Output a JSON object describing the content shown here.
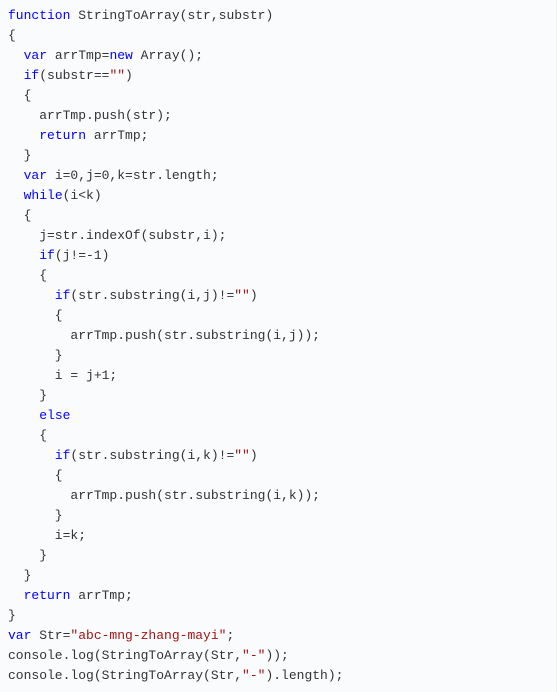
{
  "code": {
    "lines": [
      {
        "indent": 0,
        "tokens": [
          {
            "t": "function",
            "c": "kw"
          },
          {
            "t": " StringToArray(str,substr)"
          }
        ]
      },
      {
        "indent": 0,
        "tokens": [
          {
            "t": "{"
          }
        ]
      },
      {
        "indent": 1,
        "tokens": [
          {
            "t": "var",
            "c": "kw"
          },
          {
            "t": " arrTmp="
          },
          {
            "t": "new",
            "c": "kw"
          },
          {
            "t": " Array();"
          }
        ]
      },
      {
        "indent": 1,
        "tokens": [
          {
            "t": "if",
            "c": "kw"
          },
          {
            "t": "(substr=="
          },
          {
            "t": "\"\"",
            "c": "str"
          },
          {
            "t": ")"
          }
        ]
      },
      {
        "indent": 1,
        "tokens": [
          {
            "t": "{"
          }
        ]
      },
      {
        "indent": 2,
        "tokens": [
          {
            "t": "arrTmp.push(str);"
          }
        ]
      },
      {
        "indent": 2,
        "tokens": [
          {
            "t": "return",
            "c": "kw"
          },
          {
            "t": " arrTmp;"
          }
        ]
      },
      {
        "indent": 1,
        "tokens": [
          {
            "t": "}"
          }
        ]
      },
      {
        "indent": 1,
        "tokens": [
          {
            "t": "var",
            "c": "kw"
          },
          {
            "t": " i=0,j=0,k=str.length;"
          }
        ]
      },
      {
        "indent": 1,
        "tokens": [
          {
            "t": "while",
            "c": "kw"
          },
          {
            "t": "(i<k)"
          }
        ]
      },
      {
        "indent": 1,
        "tokens": [
          {
            "t": "{"
          }
        ]
      },
      {
        "indent": 2,
        "tokens": [
          {
            "t": "j=str.indexOf(substr,i);"
          }
        ]
      },
      {
        "indent": 2,
        "tokens": [
          {
            "t": "if",
            "c": "kw"
          },
          {
            "t": "(j!=-1)"
          }
        ]
      },
      {
        "indent": 2,
        "tokens": [
          {
            "t": "{"
          }
        ]
      },
      {
        "indent": 3,
        "tokens": [
          {
            "t": "if",
            "c": "kw"
          },
          {
            "t": "(str.substring(i,j)!="
          },
          {
            "t": "\"\"",
            "c": "str"
          },
          {
            "t": ")"
          }
        ]
      },
      {
        "indent": 3,
        "tokens": [
          {
            "t": "{"
          }
        ]
      },
      {
        "indent": 4,
        "tokens": [
          {
            "t": "arrTmp.push(str.substring(i,j));"
          }
        ]
      },
      {
        "indent": 3,
        "tokens": [
          {
            "t": "}"
          }
        ]
      },
      {
        "indent": 3,
        "tokens": [
          {
            "t": "i = j+1;"
          }
        ]
      },
      {
        "indent": 2,
        "tokens": [
          {
            "t": "}"
          }
        ]
      },
      {
        "indent": 2,
        "tokens": [
          {
            "t": "else",
            "c": "kw"
          }
        ]
      },
      {
        "indent": 2,
        "tokens": [
          {
            "t": "{"
          }
        ]
      },
      {
        "indent": 3,
        "tokens": [
          {
            "t": "if",
            "c": "kw"
          },
          {
            "t": "(str.substring(i,k)!="
          },
          {
            "t": "\"\"",
            "c": "str"
          },
          {
            "t": ")"
          }
        ]
      },
      {
        "indent": 3,
        "tokens": [
          {
            "t": "{"
          }
        ]
      },
      {
        "indent": 4,
        "tokens": [
          {
            "t": "arrTmp.push(str.substring(i,k));"
          }
        ]
      },
      {
        "indent": 3,
        "tokens": [
          {
            "t": "}"
          }
        ]
      },
      {
        "indent": 3,
        "tokens": [
          {
            "t": "i=k;"
          }
        ]
      },
      {
        "indent": 2,
        "tokens": [
          {
            "t": "}"
          }
        ]
      },
      {
        "indent": 1,
        "tokens": [
          {
            "t": "}"
          }
        ]
      },
      {
        "indent": 1,
        "tokens": [
          {
            "t": "return",
            "c": "kw"
          },
          {
            "t": " arrTmp;"
          }
        ]
      },
      {
        "indent": 0,
        "tokens": [
          {
            "t": "}"
          }
        ]
      },
      {
        "indent": 0,
        "tokens": [
          {
            "t": "var",
            "c": "kw"
          },
          {
            "t": " Str="
          },
          {
            "t": "\"abc-mng-zhang-mayi\"",
            "c": "str"
          },
          {
            "t": ";"
          }
        ]
      },
      {
        "indent": 0,
        "tokens": [
          {
            "t": "console.log(StringToArray(Str,"
          },
          {
            "t": "\"-\"",
            "c": "str"
          },
          {
            "t": "));"
          }
        ]
      },
      {
        "indent": 0,
        "tokens": [
          {
            "t": "console.log(StringToArray(Str,"
          },
          {
            "t": "\"-\"",
            "c": "str"
          },
          {
            "t": ").length);"
          }
        ]
      }
    ],
    "indent_unit": "  "
  }
}
